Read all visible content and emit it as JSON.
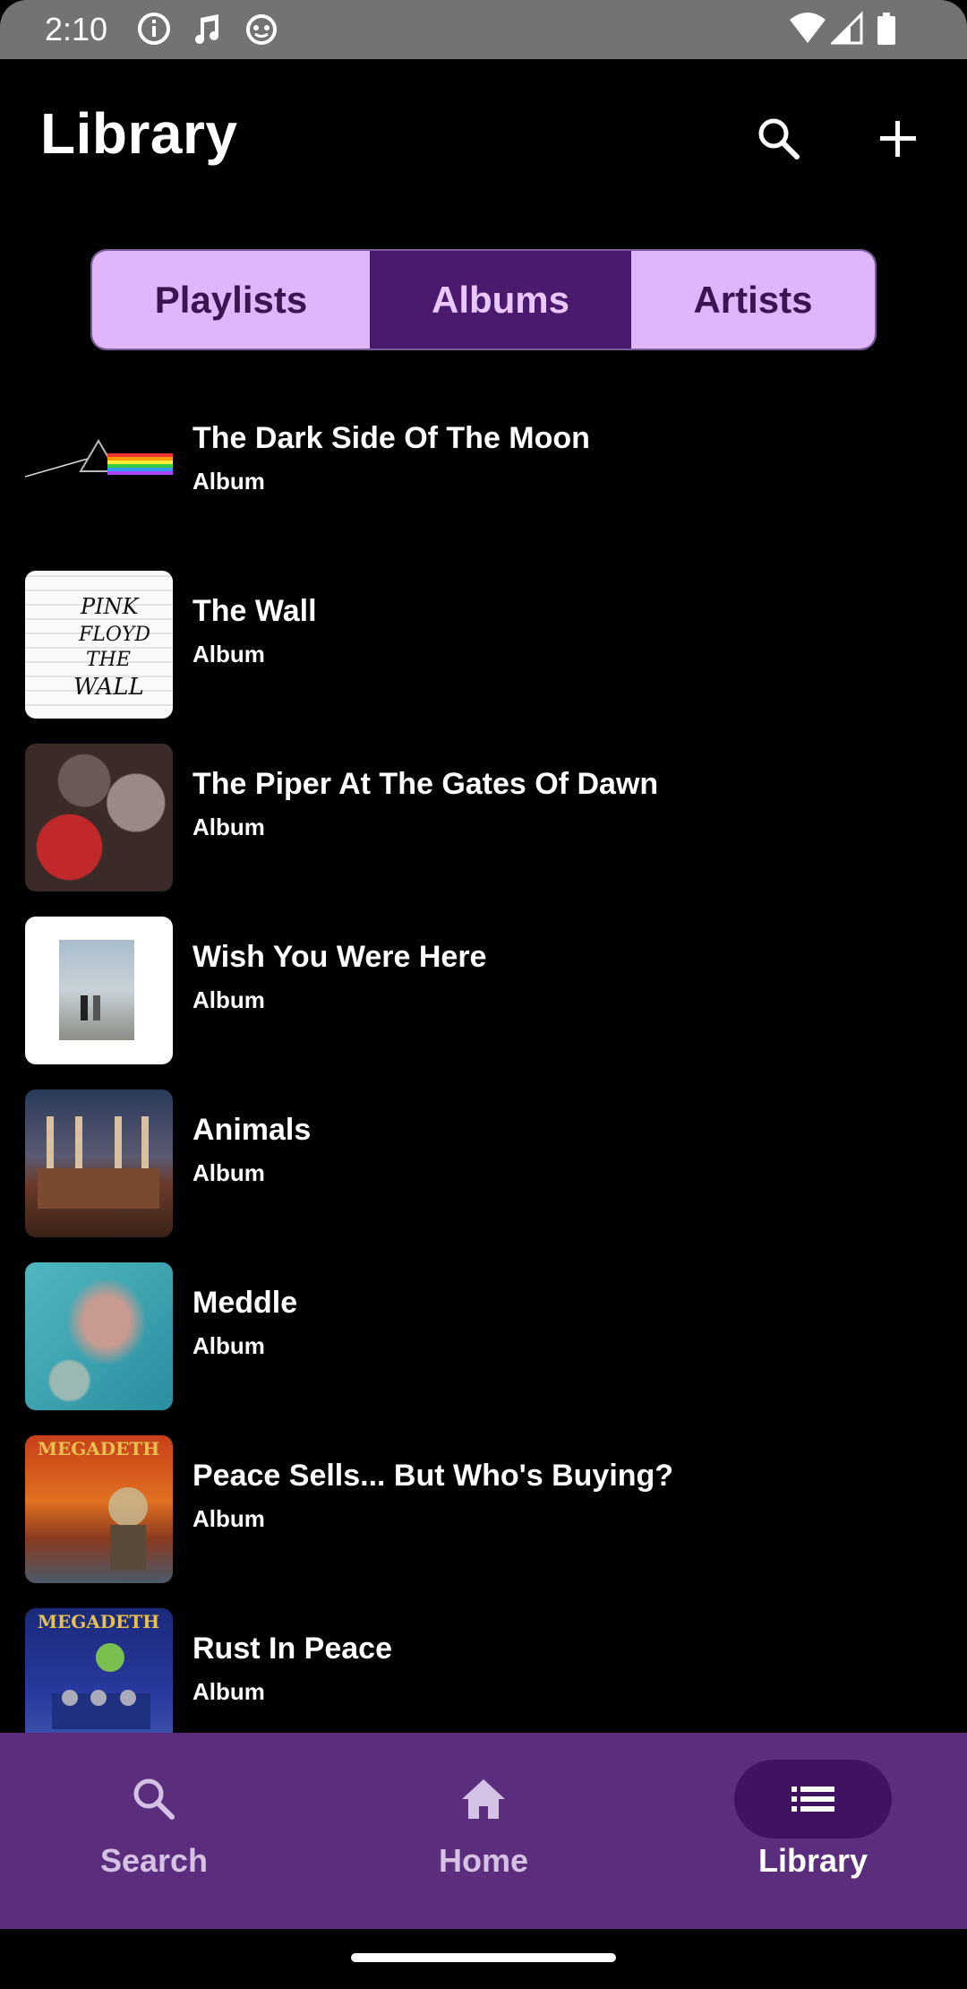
{
  "status": {
    "time": "2:10"
  },
  "header": {
    "title": "Library"
  },
  "segments": [
    {
      "label": "Playlists",
      "active": false
    },
    {
      "label": "Albums",
      "active": true
    },
    {
      "label": "Artists",
      "active": false
    }
  ],
  "albums": [
    {
      "title": "The Dark Side Of The Moon",
      "subtitle": "Album"
    },
    {
      "title": "The Wall",
      "subtitle": "Album"
    },
    {
      "title": "The Piper At The Gates Of Dawn",
      "subtitle": "Album"
    },
    {
      "title": "Wish You Were Here",
      "subtitle": "Album"
    },
    {
      "title": "Animals",
      "subtitle": "Album"
    },
    {
      "title": "Meddle",
      "subtitle": "Album"
    },
    {
      "title": "Peace Sells... But Who's Buying?",
      "subtitle": "Album"
    },
    {
      "title": "Rust In Peace",
      "subtitle": "Album"
    }
  ],
  "cover_text": {
    "wall": [
      "PINK",
      "FLOYD",
      "THE",
      "WALL"
    ],
    "megadeth": "MEGADETH"
  },
  "nav": [
    {
      "label": "Search",
      "icon": "search-icon",
      "active": false
    },
    {
      "label": "Home",
      "icon": "home-icon",
      "active": false
    },
    {
      "label": "Library",
      "icon": "list-icon",
      "active": true
    }
  ],
  "colors": {
    "nav_background": "#5a2d7d",
    "segment_active": "#4a1a6e",
    "segment_inactive": "#e0b6fb"
  }
}
